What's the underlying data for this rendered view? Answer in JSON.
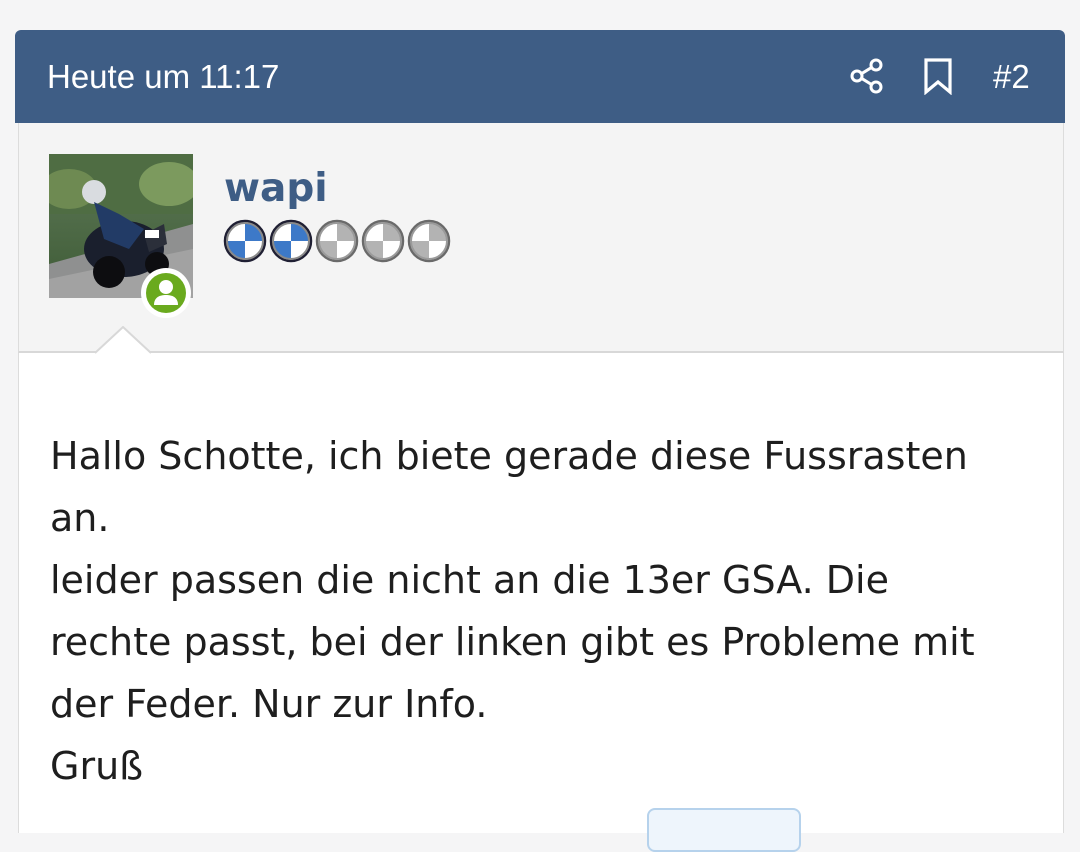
{
  "post": {
    "date": "Heute um 11:17",
    "number": "#2",
    "icons": {
      "share": "share-icon",
      "bookmark": "bookmark-icon",
      "online": "online-user-icon"
    }
  },
  "user": {
    "name": "wapi",
    "rank": {
      "filled": 2,
      "total": 5
    }
  },
  "message": {
    "text": "Hallo Schotte, ich biete gerade diese Fussrasten\nan.\nleider passen die nicht an die 13er GSA. Die\nrechte passt, bei der linken gibt es Probleme mit\nder Feder. Nur zur Info.\nGruß"
  },
  "colors": {
    "header": "#3e5d85",
    "username": "#3e5d85",
    "online": "#6aaa1e"
  }
}
